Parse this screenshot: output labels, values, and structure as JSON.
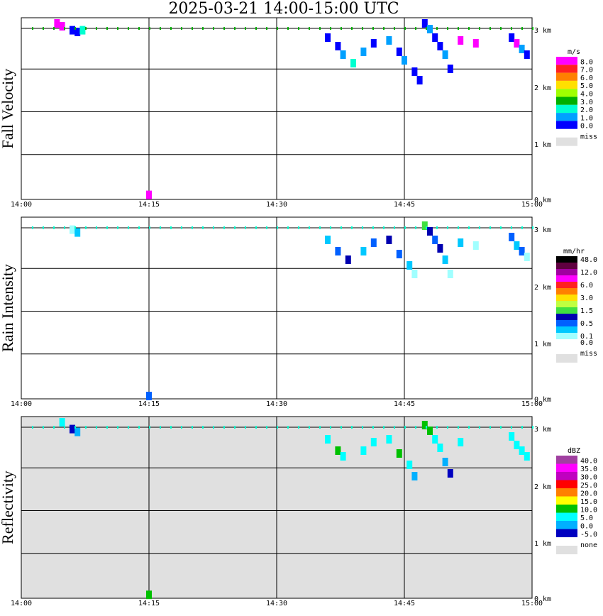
{
  "title": "2025-03-21   14:00-15:00 UTC",
  "colors": {
    "grid": "#000000",
    "reflectivity_bg": "#e0e0e0",
    "missing": "#e0e0e0"
  },
  "time_labels": [
    "14:00",
    "14:15",
    "14:30",
    "14:45",
    "15:00"
  ],
  "height_labels": [
    "0 km",
    "1 km",
    "2 km",
    "3 km"
  ],
  "chart_data": [
    {
      "type": "heatmap",
      "title": "Fall Velocity",
      "ylabel": "Fall Velocity",
      "xlabel": "",
      "x_range": [
        "14:00",
        "15:00"
      ],
      "ylim": [
        0,
        3.2
      ],
      "legend": {
        "unit": "m/s",
        "labels": [
          "8.0",
          "7.0",
          "6.0",
          "5.0",
          "4.0",
          "3.0",
          "2.0",
          "1.0",
          "0.0"
        ],
        "colors": [
          "#ff00ff",
          "#ff2020",
          "#ff8000",
          "#ffe000",
          "#a0ff00",
          "#00b000",
          "#00ffd0",
          "#00a0ff",
          "#0000ff"
        ],
        "missing_label": "miss"
      },
      "cells": [
        {
          "t": 14.07,
          "h": 3.1,
          "c": 0
        },
        {
          "t": 14.08,
          "h": 3.05,
          "c": 0
        },
        {
          "t": 14.1,
          "h": 2.98,
          "c": 8
        },
        {
          "t": 14.11,
          "h": 2.95,
          "c": 8
        },
        {
          "t": 14.12,
          "h": 2.98,
          "c": 6
        },
        {
          "t": 14.25,
          "h": 0.08,
          "c": 0
        },
        {
          "t": 14.6,
          "h": 2.85,
          "c": 8
        },
        {
          "t": 14.62,
          "h": 2.7,
          "c": 8
        },
        {
          "t": 14.63,
          "h": 2.55,
          "c": 7
        },
        {
          "t": 14.65,
          "h": 2.4,
          "c": 6
        },
        {
          "t": 14.67,
          "h": 2.6,
          "c": 7
        },
        {
          "t": 14.69,
          "h": 2.75,
          "c": 8
        },
        {
          "t": 14.72,
          "h": 2.8,
          "c": 7
        },
        {
          "t": 14.74,
          "h": 2.6,
          "c": 8
        },
        {
          "t": 14.75,
          "h": 2.45,
          "c": 7
        },
        {
          "t": 14.77,
          "h": 2.25,
          "c": 8
        },
        {
          "t": 14.78,
          "h": 2.1,
          "c": 8
        },
        {
          "t": 14.79,
          "h": 3.1,
          "c": 8
        },
        {
          "t": 14.8,
          "h": 3.0,
          "c": 7
        },
        {
          "t": 14.81,
          "h": 2.85,
          "c": 8
        },
        {
          "t": 14.82,
          "h": 2.7,
          "c": 8
        },
        {
          "t": 14.83,
          "h": 2.55,
          "c": 7
        },
        {
          "t": 14.84,
          "h": 2.3,
          "c": 8
        },
        {
          "t": 14.86,
          "h": 2.8,
          "c": 0
        },
        {
          "t": 14.89,
          "h": 2.75,
          "c": 0
        },
        {
          "t": 14.96,
          "h": 2.85,
          "c": 8
        },
        {
          "t": 14.97,
          "h": 2.75,
          "c": 0
        },
        {
          "t": 14.98,
          "h": 2.65,
          "c": 7
        },
        {
          "t": 14.99,
          "h": 2.55,
          "c": 8
        }
      ]
    },
    {
      "type": "heatmap",
      "title": "Rain Intensity",
      "ylabel": "Rain Intensity",
      "xlabel": "",
      "x_range": [
        "14:00",
        "15:00"
      ],
      "ylim": [
        0,
        3.2
      ],
      "legend": {
        "unit": "mm/hr",
        "labels": [
          "48.0",
          "",
          "12.0",
          "",
          "6.0",
          "",
          "3.0",
          "",
          "1.5",
          "",
          "0.5",
          "",
          "0.1",
          "0.0"
        ],
        "colors": [
          "#000000",
          "#600040",
          "#a000a0",
          "#ff00ff",
          "#ff2020",
          "#ff8000",
          "#ffe000",
          "#c0ff40",
          "#40e040",
          "#0000b0",
          "#0060ff",
          "#00c8ff",
          "#a0ffff",
          "#ffffff"
        ],
        "missing_label": "miss"
      },
      "cells": [
        {
          "t": 14.1,
          "h": 2.98,
          "c": 12
        },
        {
          "t": 14.11,
          "h": 2.93,
          "c": 11
        },
        {
          "t": 14.25,
          "h": 0.05,
          "c": 10
        },
        {
          "t": 14.6,
          "h": 2.8,
          "c": 11
        },
        {
          "t": 14.62,
          "h": 2.6,
          "c": 10
        },
        {
          "t": 14.64,
          "h": 2.45,
          "c": 9
        },
        {
          "t": 14.67,
          "h": 2.6,
          "c": 11
        },
        {
          "t": 14.69,
          "h": 2.75,
          "c": 10
        },
        {
          "t": 14.72,
          "h": 2.8,
          "c": 9
        },
        {
          "t": 14.74,
          "h": 2.55,
          "c": 10
        },
        {
          "t": 14.76,
          "h": 2.35,
          "c": 11
        },
        {
          "t": 14.77,
          "h": 2.2,
          "c": 12
        },
        {
          "t": 14.79,
          "h": 3.05,
          "c": 8
        },
        {
          "t": 14.8,
          "h": 2.95,
          "c": 9
        },
        {
          "t": 14.81,
          "h": 2.8,
          "c": 10
        },
        {
          "t": 14.82,
          "h": 2.65,
          "c": 9
        },
        {
          "t": 14.83,
          "h": 2.45,
          "c": 11
        },
        {
          "t": 14.84,
          "h": 2.2,
          "c": 12
        },
        {
          "t": 14.86,
          "h": 2.75,
          "c": 11
        },
        {
          "t": 14.89,
          "h": 2.7,
          "c": 12
        },
        {
          "t": 14.96,
          "h": 2.85,
          "c": 10
        },
        {
          "t": 14.97,
          "h": 2.7,
          "c": 11
        },
        {
          "t": 14.98,
          "h": 2.6,
          "c": 10
        },
        {
          "t": 14.99,
          "h": 2.5,
          "c": 12
        }
      ]
    },
    {
      "type": "heatmap",
      "title": "Reflectivity",
      "ylabel": "Reflectivity",
      "xlabel": "",
      "x_range": [
        "14:00",
        "15:00"
      ],
      "ylim": [
        0,
        3.2
      ],
      "legend": {
        "unit": "dBZ",
        "labels": [
          "40.0",
          "35.0",
          "30.0",
          "25.0",
          "20.0",
          "15.0",
          "10.0",
          "5.0",
          "0.0",
          "-5.0"
        ],
        "colors": [
          "#a040a0",
          "#ff00ff",
          "#c000c0",
          "#ff0000",
          "#ff8000",
          "#ffff00",
          "#00c000",
          "#00ffff",
          "#00b0ff",
          "#0000c0"
        ],
        "missing_label": "none"
      },
      "cells": [
        {
          "t": 14.08,
          "h": 3.1,
          "c": 7
        },
        {
          "t": 14.1,
          "h": 2.98,
          "c": 9
        },
        {
          "t": 14.11,
          "h": 2.93,
          "c": 8
        },
        {
          "t": 14.25,
          "h": 0.06,
          "c": 6
        },
        {
          "t": 14.6,
          "h": 2.8,
          "c": 7
        },
        {
          "t": 14.62,
          "h": 2.6,
          "c": 6
        },
        {
          "t": 14.63,
          "h": 2.5,
          "c": 7
        },
        {
          "t": 14.67,
          "h": 2.6,
          "c": 7
        },
        {
          "t": 14.69,
          "h": 2.75,
          "c": 7
        },
        {
          "t": 14.72,
          "h": 2.8,
          "c": 7
        },
        {
          "t": 14.74,
          "h": 2.55,
          "c": 6
        },
        {
          "t": 14.76,
          "h": 2.35,
          "c": 7
        },
        {
          "t": 14.77,
          "h": 2.15,
          "c": 8
        },
        {
          "t": 14.79,
          "h": 3.05,
          "c": 6
        },
        {
          "t": 14.8,
          "h": 2.95,
          "c": 6
        },
        {
          "t": 14.81,
          "h": 2.8,
          "c": 7
        },
        {
          "t": 14.82,
          "h": 2.65,
          "c": 7
        },
        {
          "t": 14.83,
          "h": 2.4,
          "c": 8
        },
        {
          "t": 14.84,
          "h": 2.2,
          "c": 9
        },
        {
          "t": 14.86,
          "h": 2.75,
          "c": 7
        },
        {
          "t": 14.96,
          "h": 2.85,
          "c": 7
        },
        {
          "t": 14.97,
          "h": 2.7,
          "c": 7
        },
        {
          "t": 14.98,
          "h": 2.6,
          "c": 7
        },
        {
          "t": 14.99,
          "h": 2.5,
          "c": 7
        }
      ]
    }
  ]
}
